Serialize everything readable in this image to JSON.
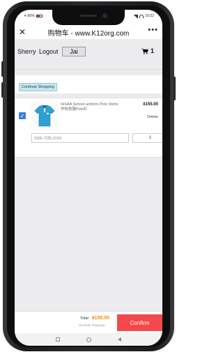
{
  "status_bar": {
    "left_text": "60%",
    "time": "10:22"
  },
  "title_bar": {
    "title": "购物车 - www.K12org.com",
    "close_icon": "close-icon",
    "more_icon": "more-icon"
  },
  "user_bar": {
    "username": "Sherry",
    "logout_label": "Logout",
    "badge_label": "Jai",
    "cart_count": "1",
    "cart_icon": "shopping-cart-icon"
  },
  "continue": {
    "label": "Continue Shopping"
  },
  "cart_item": {
    "name": "IHSAA School uniform Polo Shirts 学校校服Polo衫",
    "price": "¥155.00",
    "delete_label": "Delete",
    "size_value": "SIZE 尺码:J2XS",
    "quantity": "1",
    "checked": true
  },
  "summary": {
    "total_label": "Total:",
    "total_amount": "¥155.00",
    "exclude_note": "(Exclude shipping)",
    "confirm_label": "Confirm"
  },
  "colors": {
    "accent_red": "#f4484a",
    "price_orange": "#ff8a00",
    "checkbox_blue": "#3e7fd9",
    "continue_bg": "#c5e6ef"
  }
}
